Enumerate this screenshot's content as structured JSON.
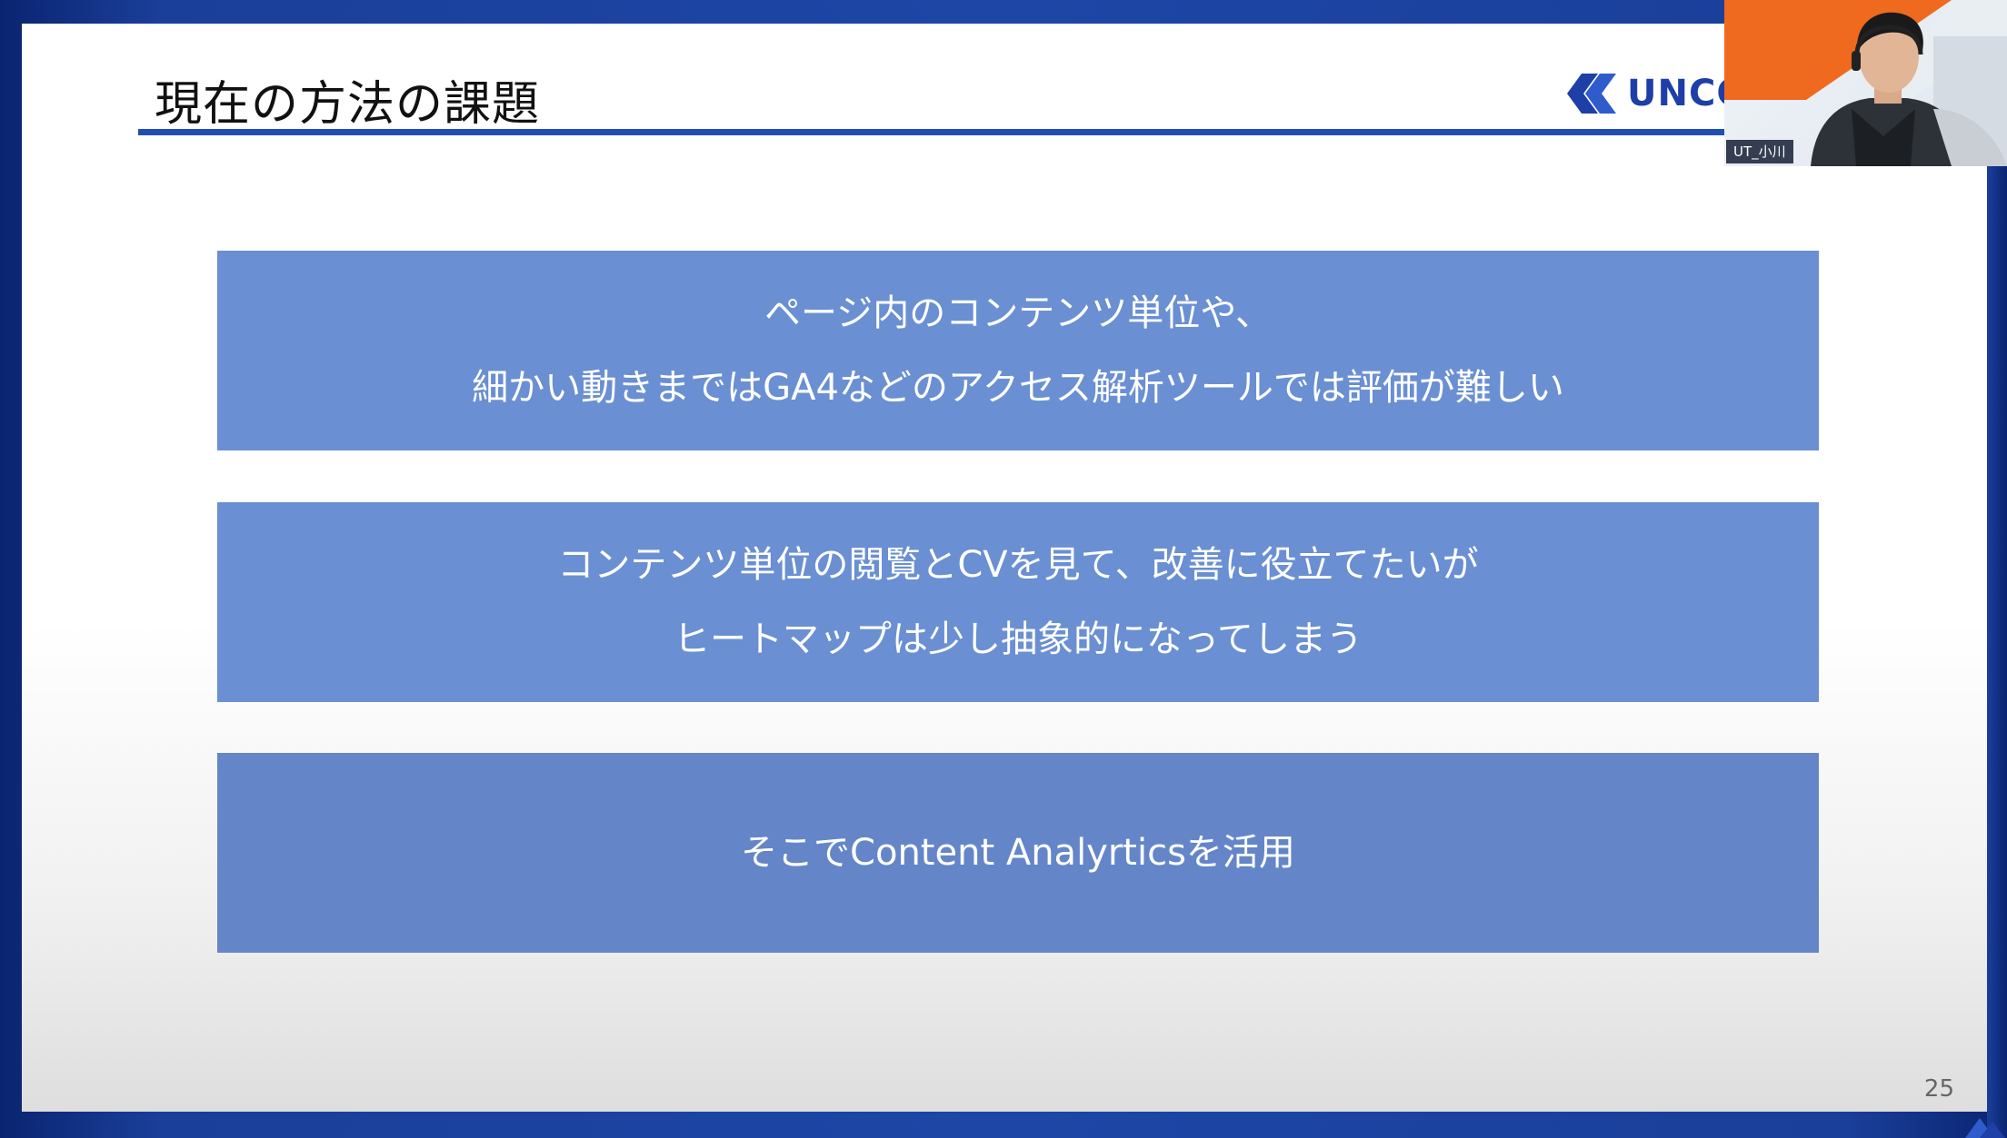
{
  "slide": {
    "title": "現在の方法の課題",
    "logo_text": "UNCC",
    "page_number": "25",
    "boxes": [
      {
        "lines": [
          "ページ内のコンテンツ単位や、",
          "細かい動きまではGA4などのアクセス解析ツールでは評価が難しい"
        ]
      },
      {
        "lines": [
          "コンテンツ単位の閲覧とCVを見て、改善に役立てたいが",
          "ヒートマップは少し抽象的になってしまう"
        ]
      },
      {
        "lines": [
          "そこでContent Analyrticsを活用"
        ]
      }
    ]
  },
  "webcam": {
    "participant_name": "UT_小川"
  },
  "colors": {
    "frame": "#1d46a6",
    "title_rule": "#1f4fb4",
    "box_fill": "#6a8fd2",
    "logo": "#1e3fa8"
  }
}
